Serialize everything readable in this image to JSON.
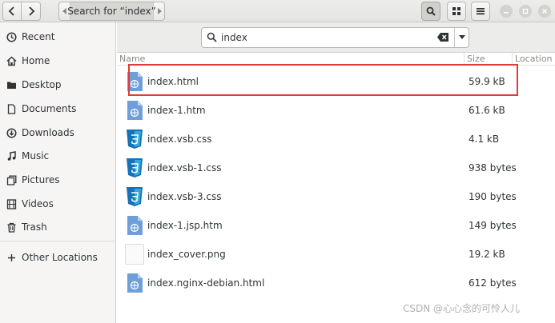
{
  "header": {
    "breadcrumb_label": "Search for “index”"
  },
  "sidebar": {
    "items": [
      {
        "label": "Recent",
        "icon": "clock-icon"
      },
      {
        "label": "Home",
        "icon": "home-icon"
      },
      {
        "label": "Desktop",
        "icon": "desktop-folder-icon"
      },
      {
        "label": "Documents",
        "icon": "document-icon"
      },
      {
        "label": "Downloads",
        "icon": "download-icon"
      },
      {
        "label": "Music",
        "icon": "music-note-icon"
      },
      {
        "label": "Pictures",
        "icon": "picture-icon"
      },
      {
        "label": "Videos",
        "icon": "film-icon"
      },
      {
        "label": "Trash",
        "icon": "trash-icon"
      }
    ],
    "other_locations": {
      "label": "Other Locations",
      "icon": "plus-icon"
    }
  },
  "search": {
    "value": "index"
  },
  "columns": {
    "name": "Name",
    "size": "Size",
    "location": "Location"
  },
  "files": [
    {
      "name": "index.html",
      "size": "59.9 kB",
      "type": "html"
    },
    {
      "name": "index-1.htm",
      "size": "61.6 kB",
      "type": "html"
    },
    {
      "name": "index.vsb.css",
      "size": "4.1 kB",
      "type": "css"
    },
    {
      "name": "index.vsb-1.css",
      "size": "938 bytes",
      "type": "css"
    },
    {
      "name": "index.vsb-3.css",
      "size": "190 bytes",
      "type": "css"
    },
    {
      "name": "index-1.jsp.htm",
      "size": "149 bytes",
      "type": "html"
    },
    {
      "name": "index_cover.png",
      "size": "19.2 kB",
      "type": "image"
    },
    {
      "name": "index.nginx-debian.html",
      "size": "612 bytes",
      "type": "html"
    }
  ],
  "watermark": "CSDN @心心念的可怜人儿",
  "colors": {
    "highlight_border": "#e03b3b",
    "html_icon": "#4a86c8",
    "css_icon": "#1572b6"
  }
}
